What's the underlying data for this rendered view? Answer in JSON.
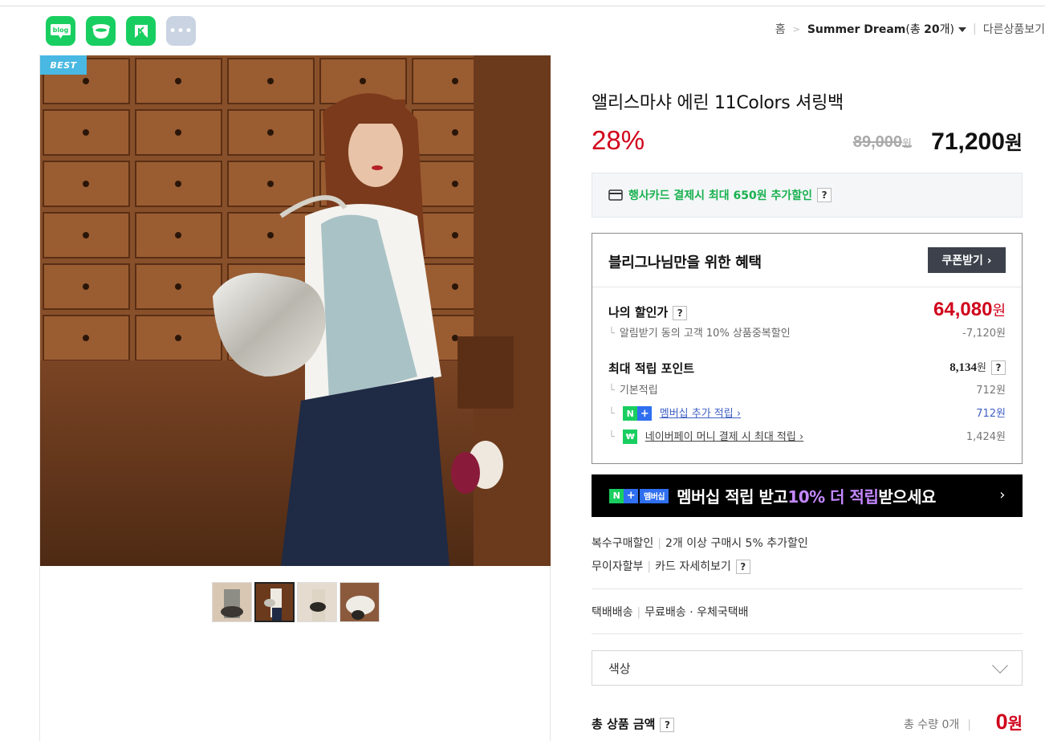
{
  "share": {
    "icons": [
      "blog-icon",
      "cafe-icon",
      "keep-icon",
      "more-icon"
    ],
    "blog_label": "blog",
    "more_label": "•••"
  },
  "breadcrumb": {
    "home": "홈",
    "store": "Summer Dream",
    "count_prefix": "(총 ",
    "count_value": "20",
    "count_suffix": "개)",
    "other": "다른상품보기"
  },
  "image": {
    "badge": "BEST",
    "thumbnails": 4,
    "selected_thumbnail": 2
  },
  "product": {
    "title": "앨리스마샤 에린 11Colors 셔링백",
    "discount": "28%",
    "original_price": "89,000",
    "price": "71,200",
    "won": "원"
  },
  "card_benefit": {
    "text": "행사카드 결제시 최대 650원 추가할인",
    "help": "?"
  },
  "benefit": {
    "heading": "블리그나님만을 위한 혜택",
    "coupon_button": "쿠폰받기 ›",
    "my_price_label": "나의 할인가",
    "my_price": "64,080",
    "my_price_sub": "알림받기 동의 고객 10% 상품중복할인",
    "my_price_diff": "-7,120원",
    "points_label": "최대 적립 포인트",
    "points": "8,134",
    "base_label": "기본적립",
    "base_value": "712원",
    "membership_label": "멤버십 추가 적립 ›",
    "membership_value": "712원",
    "npay_label": "네이버페이 머니 결제 시 최대 적립 ›",
    "npay_value": "1,424원"
  },
  "banner": {
    "badge": "멤버십",
    "text_1": "멤버십 적립 받고 ",
    "text_highlight": "10% 더 적립",
    "text_2": " 받으세요",
    "arrow": "›"
  },
  "purchase_info": {
    "multi_label": "복수구매할인",
    "multi_value": "2개 이상 구매시 5% 추가할인",
    "installment_label": "무이자할부",
    "installment_value": "카드 자세히보기",
    "shipping_label": "택배배송",
    "shipping_value": "무료배송 · 우체국택배"
  },
  "option": {
    "placeholder": "색상"
  },
  "total": {
    "label": "총 상품 금액",
    "qty": "총 수량 0개",
    "amount": "0",
    "won": "원"
  },
  "colors": {
    "naver_green": "#19ce60",
    "sale_red": "#d0021b",
    "badge_blue": "#49b8e2",
    "purple": "#c488ff"
  }
}
